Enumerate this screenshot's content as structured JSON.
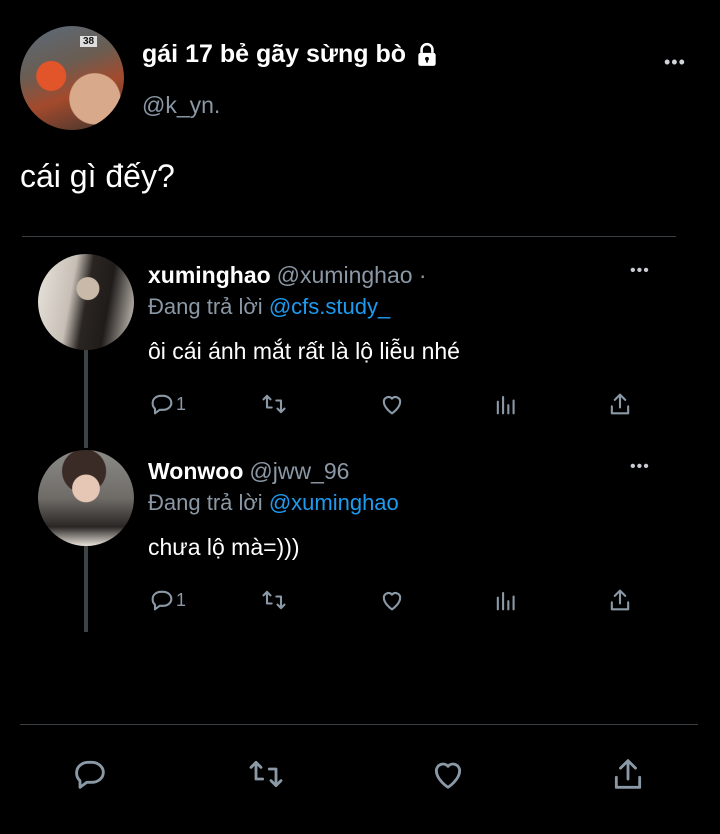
{
  "tweet": {
    "author_name": "gái 17 bẻ gãy sừng bò",
    "author_handle": "@k_yn.",
    "avatar_badge": "38",
    "text": "cái gì đếy?",
    "more": "•••"
  },
  "replies": [
    {
      "name": "xuminghao",
      "handle": "@xuminghao ·",
      "replying_prefix": "Đang trả lời ",
      "replying_to": "@cfs.study_",
      "text": "ôi cái ánh mắt rất là lộ liễu nhé",
      "reply_count": "1",
      "more": "•••"
    },
    {
      "name": "Wonwoo",
      "handle": "@jww_96",
      "replying_prefix": "Đang trả lời ",
      "replying_to": "@xuminghao",
      "text": "chưa lộ mà=)))",
      "reply_count": "1",
      "more": "•••"
    }
  ],
  "icons": {
    "lock": "lock-icon",
    "reply": "reply-icon",
    "retweet": "retweet-icon",
    "like": "like-icon",
    "stats": "stats-icon",
    "share": "share-icon"
  },
  "colors": {
    "background": "#000000",
    "text": "#ffffff",
    "secondary": "#8b98a5",
    "link": "#1d9bf0"
  }
}
